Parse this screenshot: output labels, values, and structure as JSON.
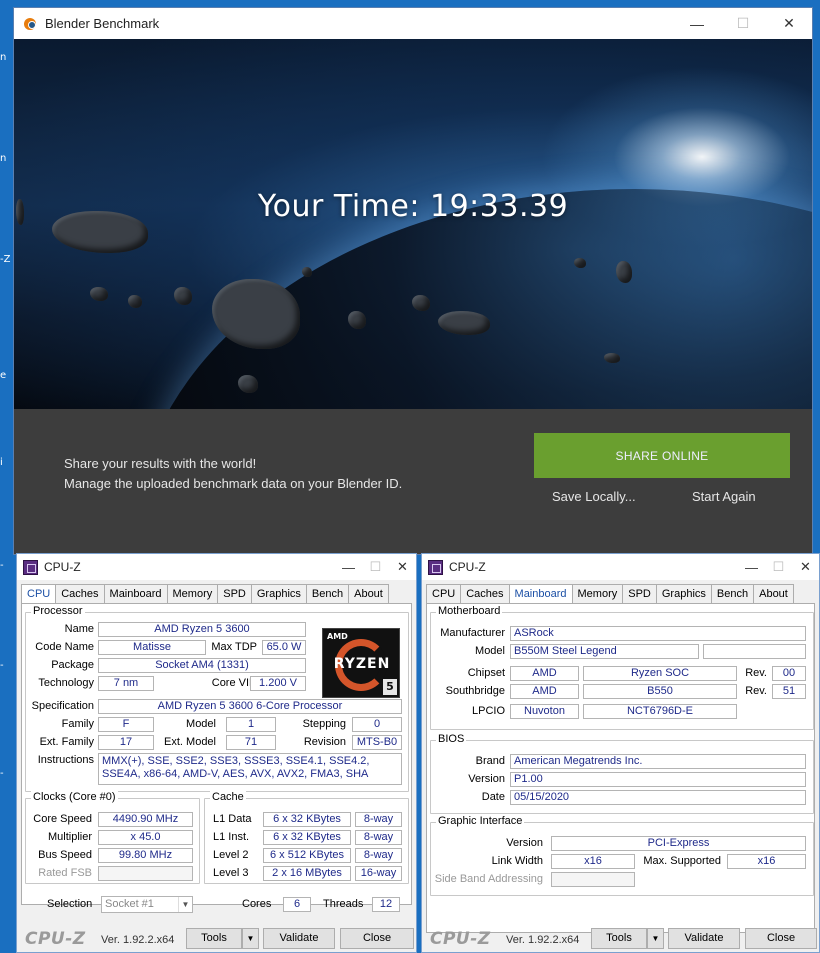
{
  "desktop": {
    "fragments": [
      "n",
      "n",
      "-Z",
      "e",
      "i",
      "-",
      "-",
      "-"
    ]
  },
  "blender": {
    "title": "Blender Benchmark",
    "your_time": "Your Time: 19:33.39",
    "share_line1": "Share your results with the world!",
    "share_line2": "Manage the uploaded benchmark data on your Blender ID.",
    "share_button": "SHARE ONLINE",
    "save_locally": "Save Locally...",
    "start_again": "Start Again",
    "accent_color": "#6a9f2f"
  },
  "cpuz_common": {
    "title": "CPU-Z",
    "tabs": [
      "CPU",
      "Caches",
      "Mainboard",
      "Memory",
      "SPD",
      "Graphics",
      "Bench",
      "About"
    ],
    "brand": "CPU-Z",
    "version": "Ver. 1.92.2.x64",
    "tools": "Tools",
    "validate": "Validate",
    "close": "Close"
  },
  "cpu": {
    "processor_title": "Processor",
    "labels": {
      "name": "Name",
      "code_name": "Code Name",
      "max_tdp": "Max TDP",
      "package": "Package",
      "technology": "Technology",
      "core_vid": "Core VID",
      "specification": "Specification",
      "family": "Family",
      "model": "Model",
      "stepping": "Stepping",
      "ext_family": "Ext. Family",
      "ext_model": "Ext. Model",
      "revision": "Revision",
      "instructions": "Instructions"
    },
    "values": {
      "name": "AMD Ryzen 5 3600",
      "code_name": "Matisse",
      "max_tdp": "65.0 W",
      "package": "Socket AM4 (1331)",
      "technology": "7 nm",
      "core_vid": "1.200 V",
      "specification": "AMD Ryzen 5 3600 6-Core Processor",
      "family": "F",
      "model": "1",
      "stepping": "0",
      "ext_family": "17",
      "ext_model": "71",
      "revision": "MTS-B0",
      "instructions": "MMX(+), SSE, SSE2, SSE3, SSSE3, SSE4.1, SSE4.2, SSE4A, x86-64, AMD-V, AES, AVX, AVX2, FMA3, SHA"
    },
    "badge": {
      "amd": "AMD",
      "ryzen": "RYZEN",
      "tier": "5"
    },
    "clocks_title": "Clocks (Core #0)",
    "clocks": {
      "core_speed_label": "Core Speed",
      "core_speed": "4490.90 MHz",
      "multiplier_label": "Multiplier",
      "multiplier": "x 45.0",
      "bus_speed_label": "Bus Speed",
      "bus_speed": "99.80 MHz",
      "rated_fsb_label": "Rated FSB",
      "rated_fsb": ""
    },
    "cache_title": "Cache",
    "cache": [
      {
        "label": "L1 Data",
        "size": "6 x 32 KBytes",
        "way": "8-way"
      },
      {
        "label": "L1 Inst.",
        "size": "6 x 32 KBytes",
        "way": "8-way"
      },
      {
        "label": "Level 2",
        "size": "6 x 512 KBytes",
        "way": "8-way"
      },
      {
        "label": "Level 3",
        "size": "2 x 16 MBytes",
        "way": "16-way"
      }
    ],
    "selection_label": "Selection",
    "selection": "Socket #1",
    "cores_label": "Cores",
    "cores": "6",
    "threads_label": "Threads",
    "threads": "12"
  },
  "mainboard": {
    "motherboard_title": "Motherboard",
    "manufacturer_label": "Manufacturer",
    "manufacturer": "ASRock",
    "model_label": "Model",
    "model": "B550M Steel Legend",
    "model_extra": "",
    "chipset_label": "Chipset",
    "chipset_vendor": "AMD",
    "chipset_name": "Ryzen SOC",
    "rev_label": "Rev.",
    "chipset_rev": "00",
    "southbridge_label": "Southbridge",
    "southbridge_vendor": "AMD",
    "southbridge_name": "B550",
    "southbridge_rev": "51",
    "lpcio_label": "LPCIO",
    "lpcio_vendor": "Nuvoton",
    "lpcio_name": "NCT6796D-E",
    "bios_title": "BIOS",
    "brand_label": "Brand",
    "brand": "American Megatrends Inc.",
    "version_label": "Version",
    "version": "P1.00",
    "date_label": "Date",
    "date": "05/15/2020",
    "gi_title": "Graphic Interface",
    "gi_version_label": "Version",
    "gi_version": "PCI-Express",
    "link_width_label": "Link Width",
    "link_width": "x16",
    "max_supported_label": "Max. Supported",
    "max_supported": "x16",
    "side_band_label": "Side Band Addressing",
    "side_band": ""
  }
}
